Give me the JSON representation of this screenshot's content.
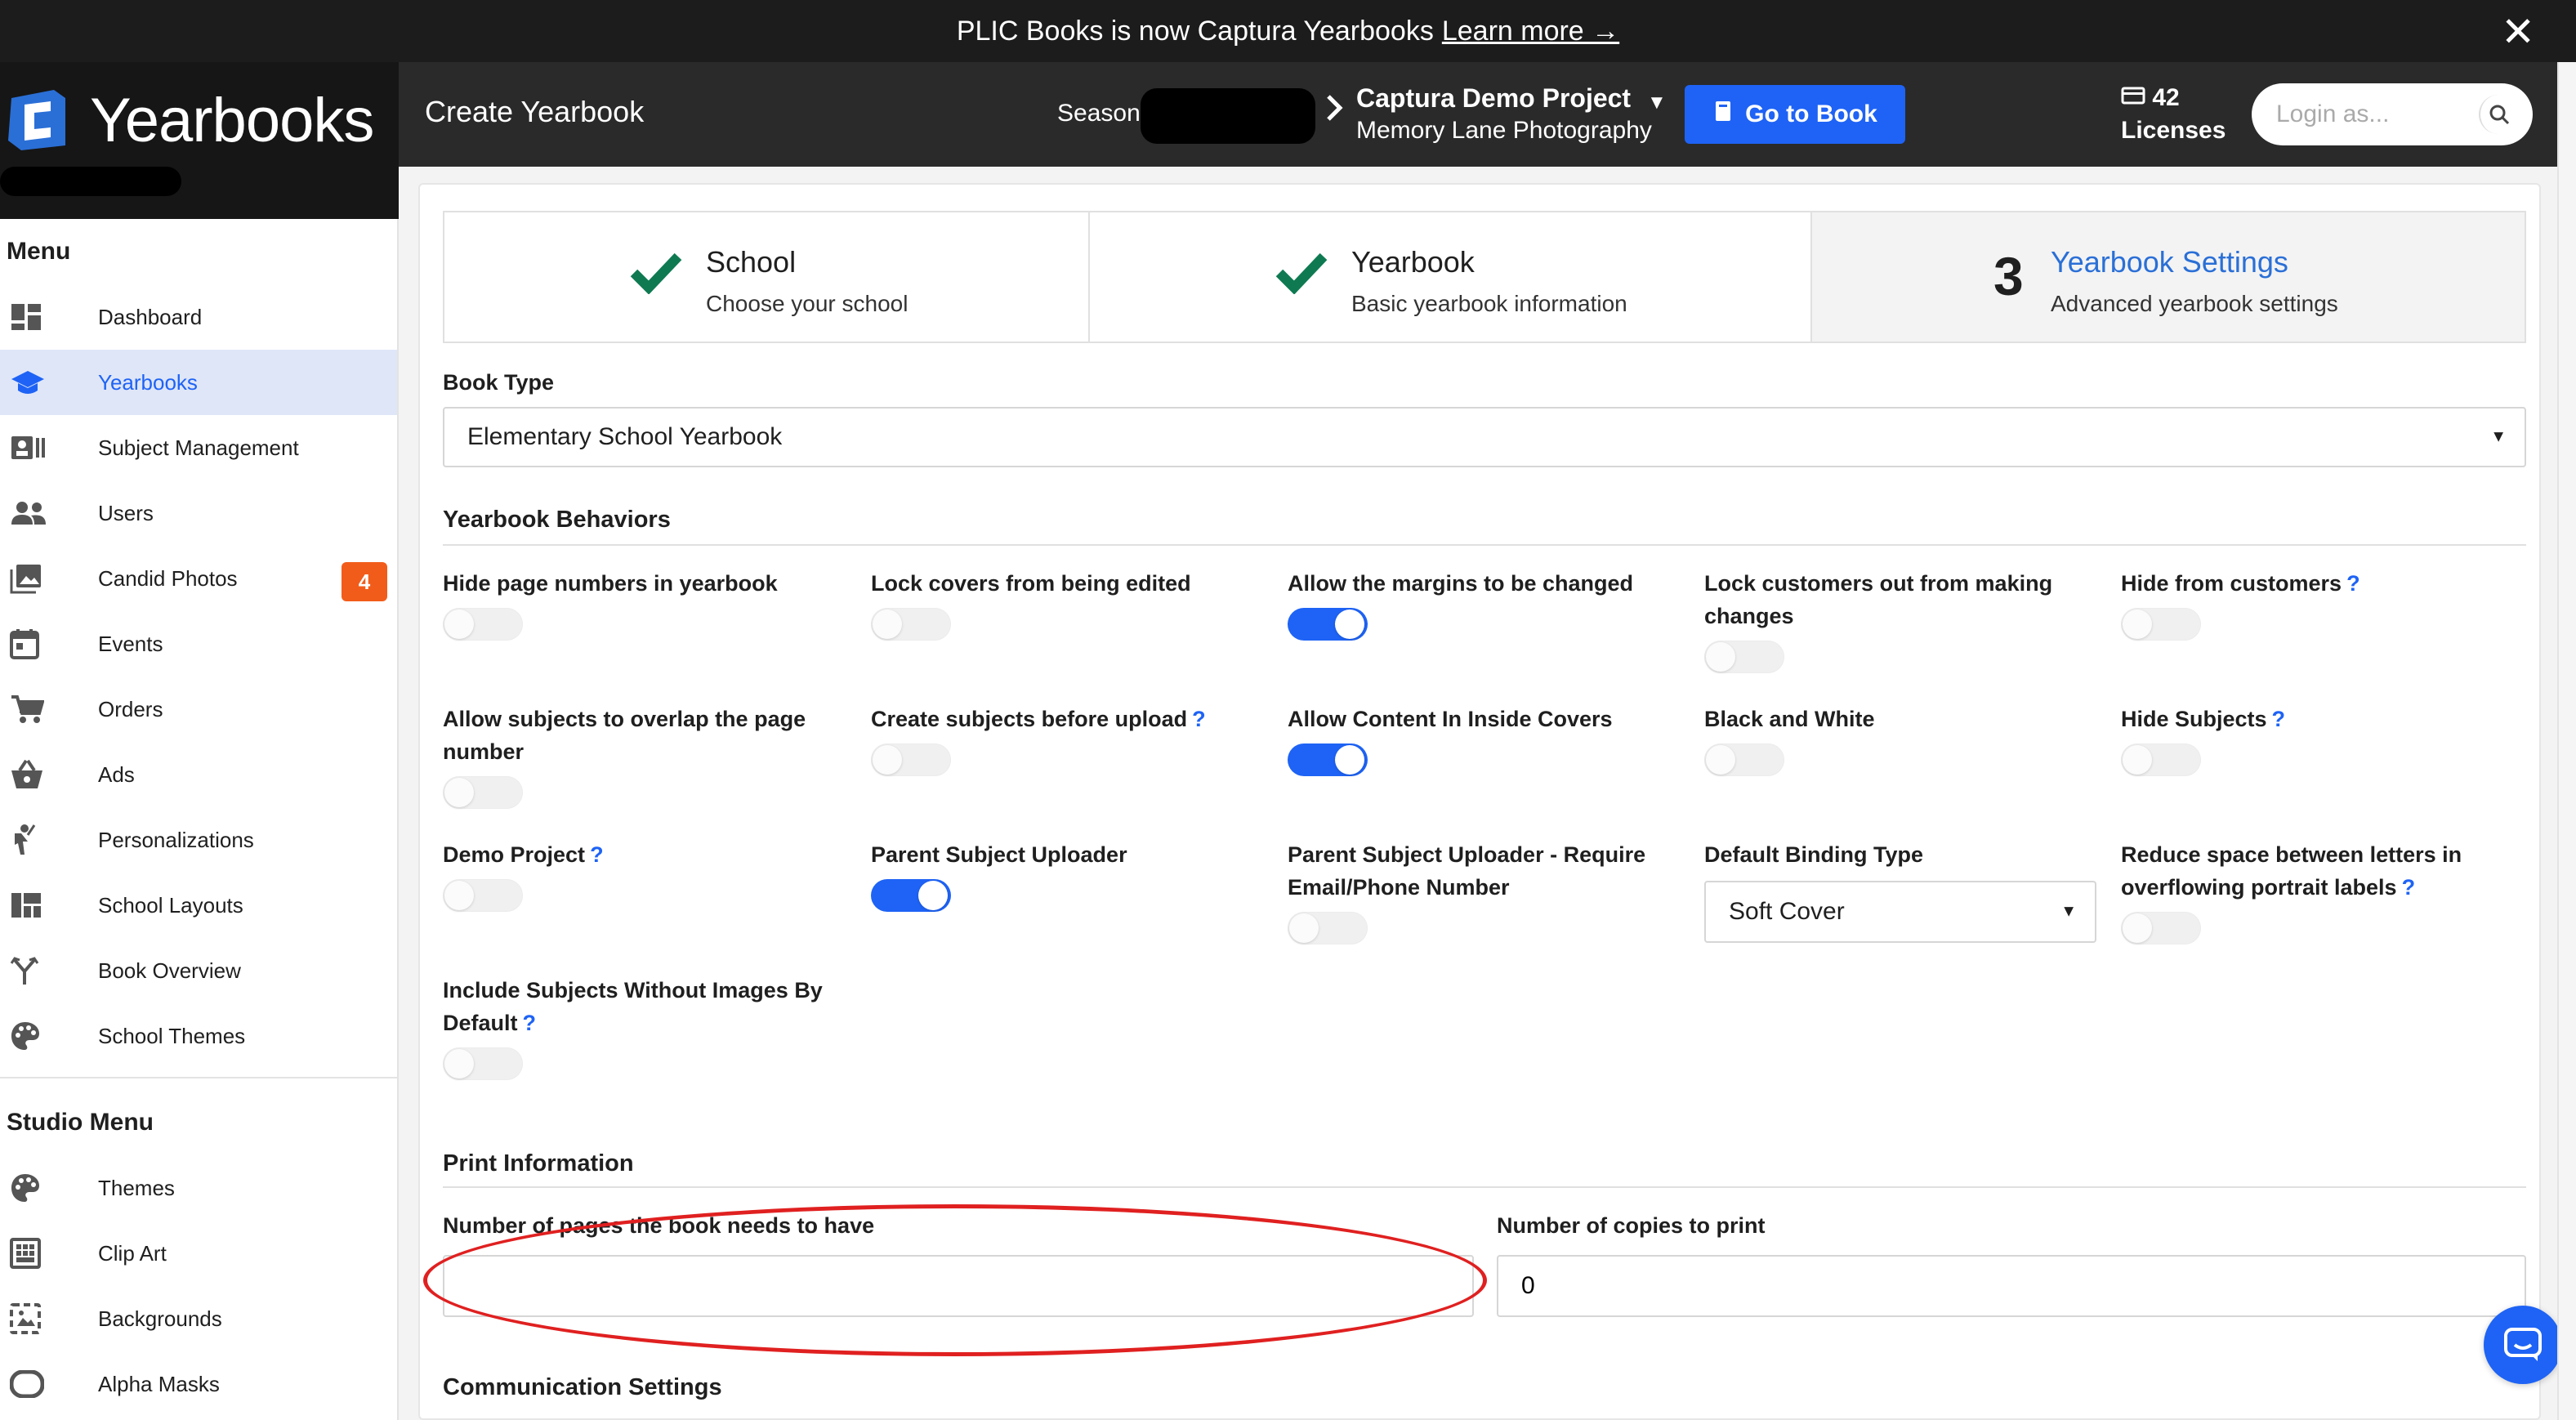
{
  "announcement": {
    "text": "PLIC Books is now Captura Yearbooks",
    "link": "Learn more →"
  },
  "brand": {
    "name": "Yearbooks"
  },
  "header": {
    "page_title": "Create Yearbook",
    "season_label": "Season:",
    "project_name": "Captura Demo Project",
    "project_sub": "Memory Lane Photography",
    "go_book": "Go to Book",
    "licenses_count": "42",
    "licenses_label": "Licenses",
    "login_placeholder": "Login as..."
  },
  "sidebar": {
    "menu_head": "Menu",
    "items": [
      {
        "label": "Dashboard",
        "icon": "dashboard-icon"
      },
      {
        "label": "Yearbooks",
        "icon": "graduation-cap-icon"
      },
      {
        "label": "Subject Management",
        "icon": "id-card-icon"
      },
      {
        "label": "Users",
        "icon": "users-icon"
      },
      {
        "label": "Candid Photos",
        "icon": "photos-icon",
        "badge": "4"
      },
      {
        "label": "Events",
        "icon": "calendar-icon"
      },
      {
        "label": "Orders",
        "icon": "cart-icon"
      },
      {
        "label": "Ads",
        "icon": "basket-icon"
      },
      {
        "label": "Personalizations",
        "icon": "person-icon"
      },
      {
        "label": "School Layouts",
        "icon": "layout-icon"
      },
      {
        "label": "Book Overview",
        "icon": "branch-icon"
      },
      {
        "label": "School Themes",
        "icon": "palette-icon"
      }
    ],
    "studio_head": "Studio Menu",
    "studio_items": [
      {
        "label": "Themes",
        "icon": "palette-icon"
      },
      {
        "label": "Clip Art",
        "icon": "clipart-icon"
      },
      {
        "label": "Backgrounds",
        "icon": "background-icon"
      },
      {
        "label": "Alpha Masks",
        "icon": "mask-icon"
      }
    ]
  },
  "stepper": {
    "steps": [
      {
        "title": "School",
        "sub": "Choose your school",
        "state": "done"
      },
      {
        "title": "Yearbook",
        "sub": "Basic yearbook information",
        "state": "done"
      },
      {
        "number": "3",
        "title": "Yearbook Settings",
        "sub": "Advanced yearbook settings",
        "state": "active"
      }
    ]
  },
  "book_type": {
    "label": "Book Type",
    "value": "Elementary School Yearbook"
  },
  "behaviors": {
    "title": "Yearbook Behaviors",
    "options": [
      {
        "label": "Hide page numbers in yearbook",
        "on": false,
        "help": false
      },
      {
        "label": "Lock covers from being edited",
        "on": false,
        "help": false
      },
      {
        "label": "Allow the margins to be changed",
        "on": true,
        "help": false
      },
      {
        "label": "Lock customers out from making changes",
        "on": false,
        "help": false
      },
      {
        "label": "Hide from customers",
        "on": false,
        "help": true
      },
      {
        "label": "Allow subjects to overlap the page number",
        "on": false,
        "help": false
      },
      {
        "label": "Create subjects before upload",
        "on": false,
        "help": true
      },
      {
        "label": "Allow Content In Inside Covers",
        "on": true,
        "help": false
      },
      {
        "label": "Black and White",
        "on": false,
        "help": false
      },
      {
        "label": "Hide Subjects",
        "on": false,
        "help": true
      },
      {
        "label": "Demo Project",
        "on": false,
        "help": true
      },
      {
        "label": "Parent Subject Uploader",
        "on": true,
        "help": false
      },
      {
        "label": "Parent Subject Uploader - Require Email/Phone Number",
        "on": false,
        "help": false
      },
      {
        "label": "Reduce space between letters in overflowing portrait labels",
        "on": false,
        "help": true
      },
      {
        "label": "Include Subjects Without Images By Default",
        "on": false,
        "help": true
      }
    ],
    "binding_label": "Default Binding Type",
    "binding_value": "Soft Cover",
    "help_mark": "?"
  },
  "print": {
    "title": "Print Information",
    "pages_label": "Number of pages the book needs to have",
    "pages_value": "",
    "copies_label": "Number of copies to print",
    "copies_value": "0"
  },
  "communication": {
    "title": "Communication Settings"
  },
  "colors": {
    "accent": "#1e63f5",
    "badge": "#f25c1a",
    "check": "#0f7a52",
    "annotation": "#e02020"
  }
}
